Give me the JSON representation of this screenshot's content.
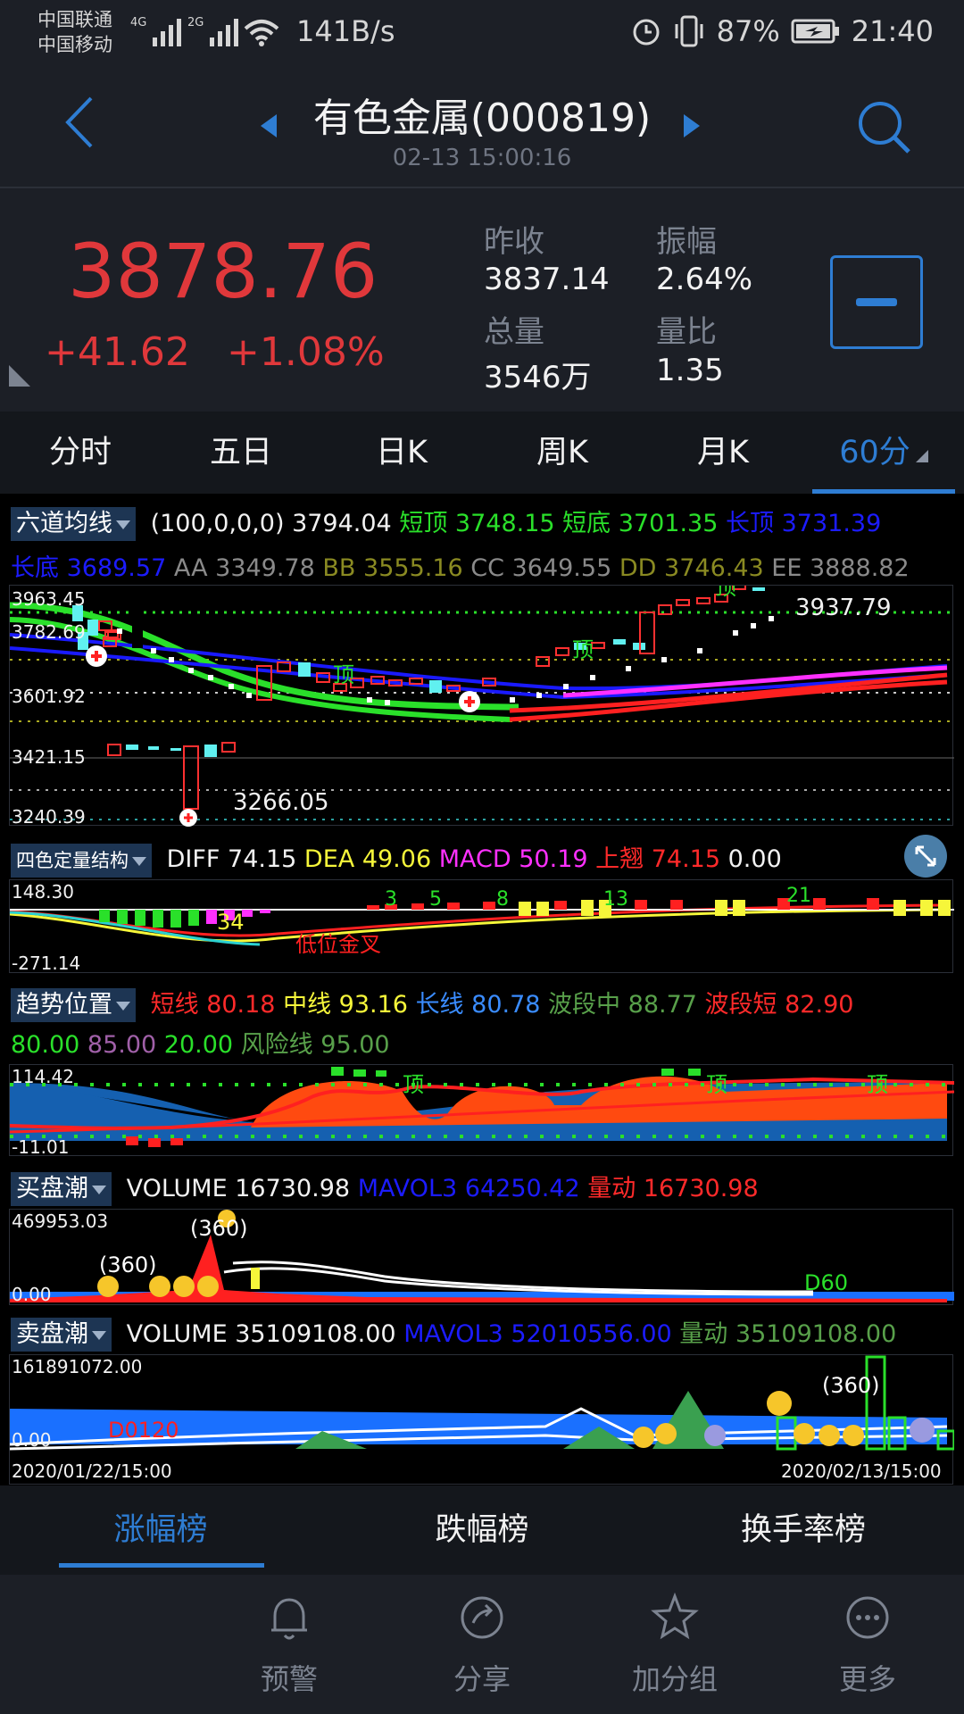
{
  "status_bar": {
    "carrier_1": "中国联通",
    "carrier_2": "中国移动",
    "net_1": "4G",
    "net_2": "2G",
    "speed": "141B/s",
    "battery": "87%",
    "time": "21:40"
  },
  "header": {
    "title": "有色金属(000819)",
    "datetime": "02-13 15:00:16"
  },
  "quote": {
    "price": "3878.76",
    "change": "+41.62",
    "change_pct": "+1.08%",
    "prev_close_label": "昨收",
    "prev_close": "3837.14",
    "amplitude_label": "振幅",
    "amplitude": "2.64%",
    "volume_label": "总量",
    "volume": "3546万",
    "vol_ratio_label": "量比",
    "vol_ratio": "1.35"
  },
  "tabs": [
    "分时",
    "五日",
    "日K",
    "周K",
    "月K",
    "60分"
  ],
  "main_indicator": {
    "name": "六道均线",
    "params": "(100,0,0,0)",
    "value": "3794.04",
    "short_top_label": "短顶",
    "short_top": "3748.15",
    "short_bottom_label": "短底",
    "short_bottom": "3701.35",
    "long_top_label": "长顶",
    "long_top": "3731.39",
    "long_bottom_label": "长底",
    "long_bottom": "3689.57",
    "aa_label": "AA",
    "aa": "3349.78",
    "bb_label": "BB",
    "bb": "3555.16",
    "cc_label": "CC",
    "cc": "3649.55",
    "dd_label": "DD",
    "dd": "3746.43",
    "ee_label": "EE",
    "ee": "3888.82"
  },
  "main_chart": {
    "axis": [
      "3963.45",
      "3782.69",
      "3601.92",
      "3421.15",
      "3240.39"
    ],
    "low_label": "3266.05",
    "high_label": "3937.79",
    "mark_top": "顶"
  },
  "macd": {
    "name": "四色定量结构",
    "diff_label": "DIFF",
    "diff": "74.15",
    "dea_label": "DEA",
    "dea": "49.06",
    "macd_label": "MACD",
    "macd": "50.19",
    "up_label": "上翘",
    "up": "74.15",
    "extra": "0.00",
    "axis_top": "148.30",
    "axis_bottom": "-271.14",
    "mark_34": "34",
    "mark_cross": "低位金叉",
    "counts": [
      "3",
      "5",
      "8",
      "13",
      "21"
    ]
  },
  "trend": {
    "name": "趋势位置",
    "short_label": "短线",
    "short": "80.18",
    "mid_label": "中线",
    "mid": "93.16",
    "long_label": "长线",
    "long": "80.78",
    "wave_mid_label": "波段中",
    "wave_mid": "88.77",
    "wave_short_label": "波段短",
    "wave_short": "82.90",
    "l1": "80.00",
    "l2": "85.00",
    "l3": "20.00",
    "risk_label": "风险线",
    "risk": "95.00",
    "axis_top": "114.42",
    "axis_bottom": "-11.01",
    "mark_top": "顶"
  },
  "buy_tide": {
    "name": "买盘潮",
    "vol_label": "VOLUME",
    "vol": "16730.98",
    "mavol_label": "MAVOL3",
    "mavol": "64250.42",
    "move_label": "量动",
    "move": "16730.98",
    "axis_top": "469953.03",
    "axis_bottom": "0.00",
    "mark_360": "(360)",
    "mark_d60": "D60"
  },
  "sell_tide": {
    "name": "卖盘潮",
    "vol_label": "VOLUME",
    "vol": "35109108.00",
    "mavol_label": "MAVOL3",
    "mavol": "52010556.00",
    "move_label": "量动",
    "move": "35109108.00",
    "axis_top": "161891072.00",
    "axis_bottom": "0.00",
    "mark_360": "(360)",
    "mark_d": "D0120",
    "date_start": "2020/01/22/15:00",
    "date_end": "2020/02/13/15:00"
  },
  "rank_tabs": [
    "涨幅榜",
    "跌幅榜",
    "换手率榜"
  ],
  "nav": [
    "预警",
    "分享",
    "加分组",
    "更多"
  ]
}
